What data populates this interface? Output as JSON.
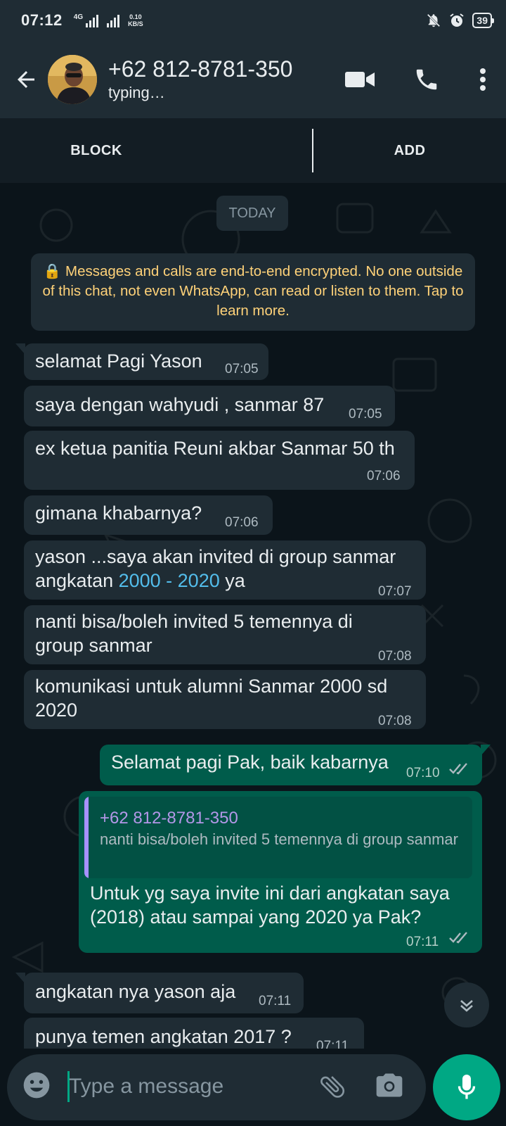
{
  "status_bar": {
    "time": "07:12",
    "network": "4G",
    "speed_value": "0.10",
    "speed_unit": "KB/S",
    "battery": "39"
  },
  "header": {
    "contact_name": "+62 812-8781-350",
    "contact_status": "typing…"
  },
  "actions": {
    "block_label": "BLOCK",
    "add_label": "ADD"
  },
  "chat": {
    "date_chip": "TODAY",
    "encryption_notice": "🔒 Messages and calls are end-to-end encrypted. No one outside of this chat, not even WhatsApp, can read or listen to them. Tap to learn more.",
    "messages": [
      {
        "direction": "in",
        "text": "selamat Pagi Yason",
        "time": "07:05"
      },
      {
        "direction": "in",
        "text": "saya dengan wahyudi , sanmar 87",
        "time": "07:05"
      },
      {
        "direction": "in",
        "text": "ex ketua panitia Reuni akbar Sanmar 50 th",
        "time": "07:06"
      },
      {
        "direction": "in",
        "text": "gimana khabarnya?",
        "time": "07:06"
      },
      {
        "direction": "in",
        "text_line1": "yason ...saya akan invited di group sanmar",
        "text_line2_a": "angkatan ",
        "text_line2_link": "2000 - 2020",
        "text_line2_b": " ya",
        "time": "07:07"
      },
      {
        "direction": "in",
        "text_line1": "nanti bisa/boleh invited 5 temennya di",
        "text_line2": "group sanmar",
        "time": "07:08"
      },
      {
        "direction": "in",
        "text_line1": "komunikasi untuk alumni Sanmar 2000 sd",
        "text_line2": "2020",
        "time": "07:08"
      },
      {
        "direction": "out",
        "text": "Selamat pagi Pak, baik kabarnya",
        "time": "07:10",
        "status": "read"
      },
      {
        "direction": "out",
        "quote_name": "+62 812-8781-350",
        "quote_text": "nanti bisa/boleh invited 5 temennya di group sanmar",
        "text_line1": "Untuk yg saya invite ini dari angkatan saya",
        "text_line2": "(2018) atau sampai yang 2020 ya Pak?",
        "time": "07:11",
        "status": "read"
      },
      {
        "direction": "in",
        "text": "angkatan nya yason aja",
        "time": "07:11"
      },
      {
        "direction": "in",
        "text": "punya temen angkatan 2017 ?",
        "time": "07:11"
      }
    ]
  },
  "composer": {
    "placeholder": "Type a message"
  },
  "colors": {
    "background": "#0b141a",
    "header": "#1f2c34",
    "incoming_bubble": "#1f2c34",
    "outgoing_bubble": "#005c4b",
    "accent": "#00a884",
    "link": "#53bdeb",
    "encryption_text": "#ffd279",
    "quote_name": "#b497e8"
  },
  "icons": [
    "back-arrow-icon",
    "video-call-icon",
    "voice-call-icon",
    "more-options-icon",
    "lock-icon",
    "double-check-icon",
    "chevron-down-icon",
    "emoji-icon",
    "attach-icon",
    "camera-icon",
    "mic-icon",
    "mute-icon",
    "alarm-icon"
  ]
}
